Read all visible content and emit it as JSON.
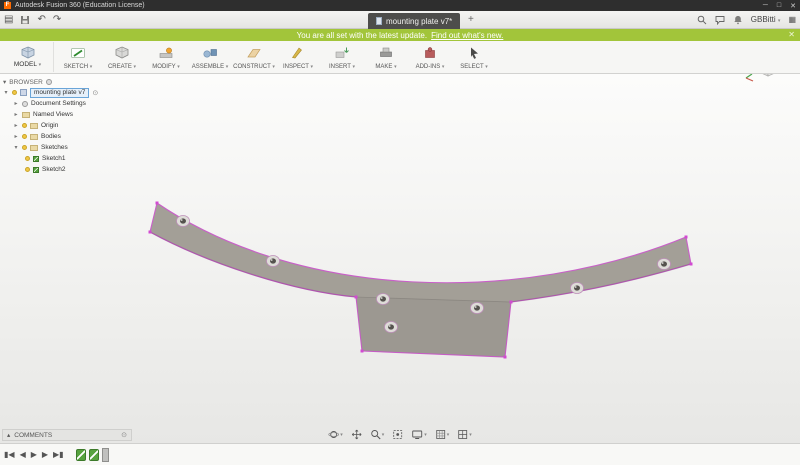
{
  "window": {
    "title": "Autodesk Fusion 360 (Education License)"
  },
  "icons": {
    "logo": "F",
    "minimize": "─",
    "maximize": "□",
    "close": "✕",
    "menu": "▤",
    "undo": "↶",
    "redo": "↷",
    "plus": "+",
    "apps": "▦",
    "caret": "▾",
    "tree_expanded": "▾",
    "tree_collapsed": "▸",
    "target": "⊙",
    "home": "⌂",
    "collapse_up": "▴",
    "skip_start": "▮◀",
    "step_back": "◀",
    "play": "▶",
    "step_forward": "▶",
    "skip_end": "▶▮",
    "banner_close": "✕"
  },
  "topbar": {
    "tab_title": "mounting plate v7*",
    "user": "GBBitti"
  },
  "banner": {
    "message": "You are all set with the latest update.",
    "link": "Find out what's new."
  },
  "ribbon": {
    "workspace": "MODEL",
    "groups": [
      {
        "label": "SKETCH"
      },
      {
        "label": "CREATE"
      },
      {
        "label": "MODIFY"
      },
      {
        "label": "ASSEMBLE"
      },
      {
        "label": "CONSTRUCT"
      },
      {
        "label": "INSPECT"
      },
      {
        "label": "INSERT"
      },
      {
        "label": "MAKE"
      },
      {
        "label": "ADD-INS"
      },
      {
        "label": "SELECT"
      }
    ]
  },
  "browser": {
    "title": "BROWSER",
    "root": "mounting plate v7",
    "items": [
      "Document Settings",
      "Named Views",
      "Origin",
      "Bodies",
      "Sketches"
    ],
    "sketches": [
      "Sketch1",
      "Sketch2"
    ]
  },
  "comments": {
    "label": "COMMENTS"
  },
  "colors": {
    "accent_green": "#a2c53a",
    "selection_magenta": "#cc4ccc",
    "plate_gray": "#a39f97"
  }
}
